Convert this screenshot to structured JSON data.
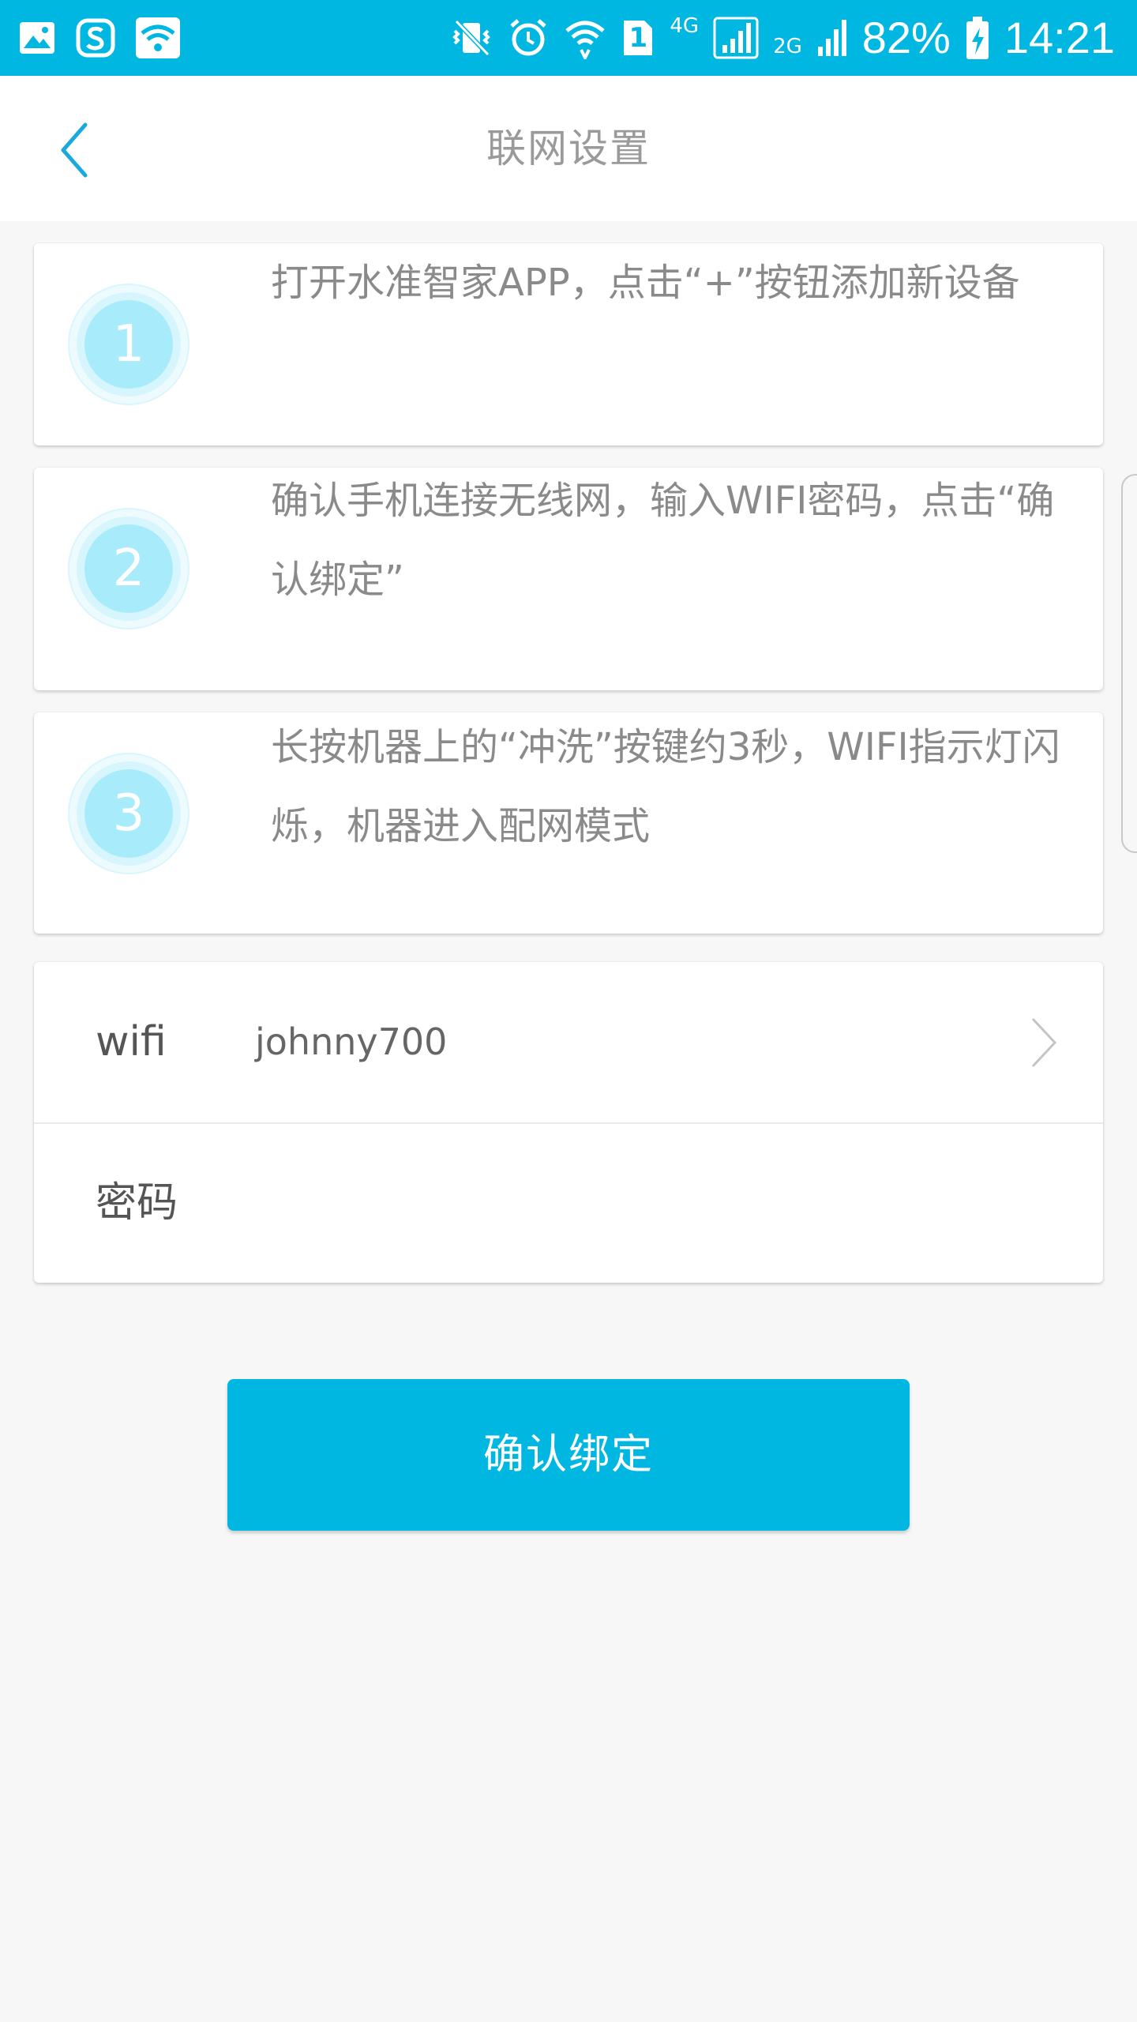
{
  "status_bar": {
    "battery": "82%",
    "time": "14:21",
    "sim_badge": "1",
    "net_4g": "4G",
    "net_2g": "2G",
    "icons": [
      "gallery-icon",
      "sogou-icon",
      "wifi-app-icon",
      "vibrate-icon",
      "alarm-icon",
      "wifi-signal-icon",
      "sim-icon",
      "cell-signal-icon",
      "cell-signal-2-icon",
      "battery-icon"
    ]
  },
  "header": {
    "title": "联网设置",
    "back_icon": "chevron-left-icon"
  },
  "steps": [
    {
      "number": "1",
      "text": "打开水准智家APP，点击“+”按钮添加新设备"
    },
    {
      "number": "2",
      "text": "确认手机连接无线网，输入WIFI密码，点击“确认绑定”"
    },
    {
      "number": "3",
      "text": "长按机器上的“冲洗”按键约3秒，WIFI指示灯闪烁，机器进入配网模式"
    }
  ],
  "form": {
    "wifi_label": "wifi",
    "wifi_value": "johnny700",
    "password_label": "密码",
    "password_value": ""
  },
  "confirm_button": "确认绑定",
  "colors": {
    "accent": "#00b7e2",
    "badge_light": "#a8ecfb",
    "badge_ring": "#d9f6fd"
  }
}
